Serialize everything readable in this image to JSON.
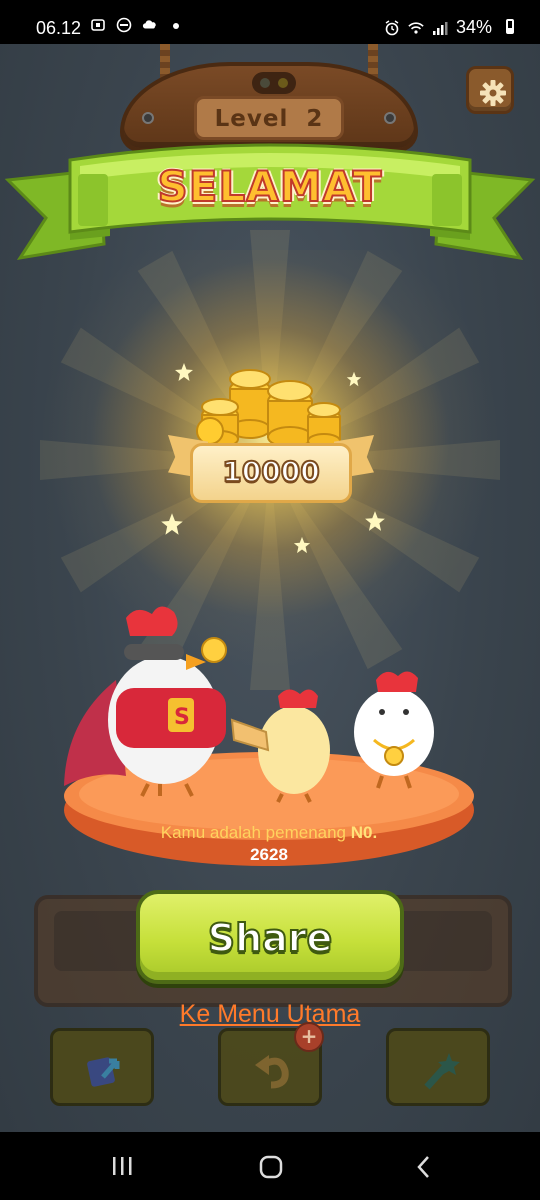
{
  "status_bar": {
    "time": "06.12",
    "battery": "34%",
    "icons_left": [
      "screenshot-icon",
      "dnd-icon",
      "cloud-icon",
      "dot-icon"
    ],
    "icons_right": [
      "alarm-icon",
      "wifi-icon",
      "signal-icon",
      "battery-icon"
    ]
  },
  "level": {
    "label": "Level",
    "number": "2"
  },
  "banner": {
    "title": "SELAMAT"
  },
  "reward": {
    "amount": "10000"
  },
  "winner": {
    "text": "Kamu adalah pemenang",
    "no_label": "N0.",
    "number": "2628"
  },
  "actions": {
    "share_label": "Share",
    "menu_label": "Ke Menu Utama"
  },
  "tools": [
    {
      "icon": "shuffle-icon"
    },
    {
      "icon": "undo-icon",
      "badge": "+"
    },
    {
      "icon": "magic-icon"
    }
  ],
  "nav": [
    "recent-apps-icon",
    "home-icon",
    "back-icon"
  ],
  "colors": {
    "background": "#3a444d",
    "ribbon_green": "#9ad22e",
    "title_yellow": "#ffbf2f",
    "share_green": "#c6e03a",
    "link_orange": "#ff7a2a",
    "stage_orange": "#f07a3a"
  }
}
